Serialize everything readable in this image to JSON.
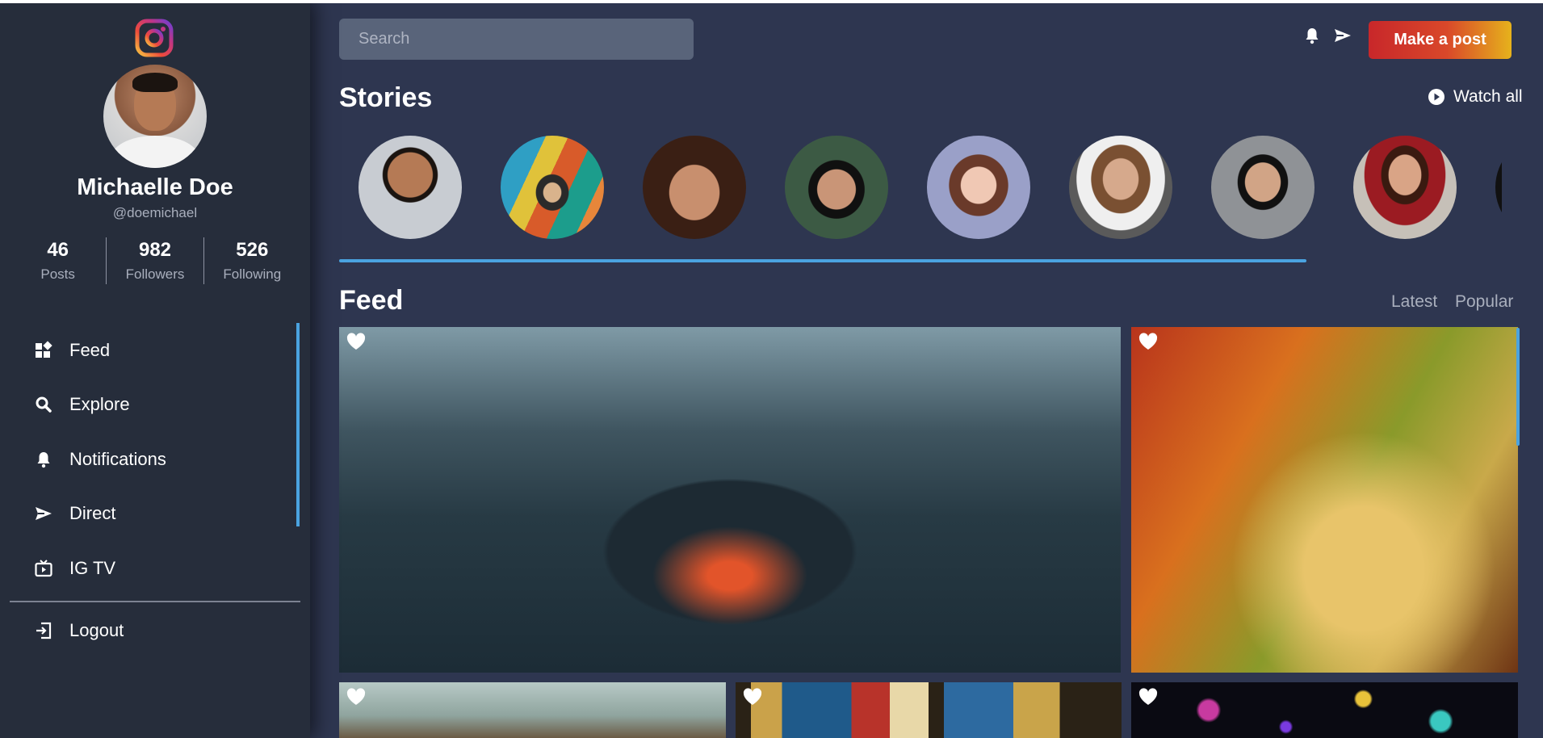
{
  "profile": {
    "name": "Michaelle Doe",
    "handle": "@doemichael",
    "stats": [
      {
        "value": "46",
        "label": "Posts"
      },
      {
        "value": "982",
        "label": "Followers"
      },
      {
        "value": "526",
        "label": "Following"
      }
    ]
  },
  "nav": {
    "items": [
      {
        "label": "Feed",
        "icon": "feed-icon"
      },
      {
        "label": "Explore",
        "icon": "search-icon"
      },
      {
        "label": "Notifications",
        "icon": "bell-icon"
      },
      {
        "label": "Direct",
        "icon": "send-icon"
      },
      {
        "label": "IG TV",
        "icon": "tv-icon"
      }
    ],
    "logout": {
      "label": "Logout",
      "icon": "logout-icon"
    },
    "active": "Feed"
  },
  "header": {
    "search_placeholder": "Search",
    "make_post_label": "Make a post"
  },
  "stories": {
    "title": "Stories",
    "watch_all_label": "Watch all"
  },
  "feed": {
    "title": "Feed",
    "tabs": [
      "Latest",
      "Popular"
    ]
  },
  "colors": {
    "background": "#2e3650",
    "sidebar": "#262d3b",
    "accent": "#4aa3e0",
    "button_gradient_start": "#c8272a",
    "button_gradient_end": "#e6b21c"
  }
}
